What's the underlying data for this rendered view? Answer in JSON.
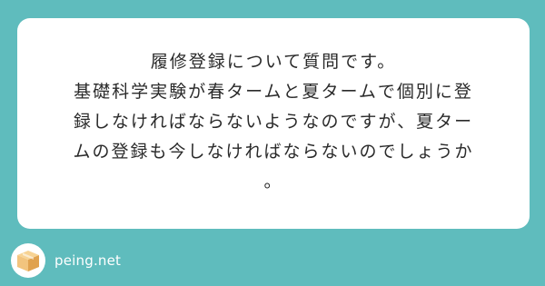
{
  "question": {
    "lines": [
      "履修登録について質問です。",
      "基礎科学実験が春タームと夏タームで個別に登",
      "録しなければならないようなのですが、夏ター",
      "ムの登録も今しなければならないのでしょうか",
      "。"
    ]
  },
  "footer": {
    "logo_icon": "box-icon",
    "brand": "peing.net"
  },
  "colors": {
    "background": "#5fbcbd",
    "card": "#ffffff",
    "box_light": "#f2c47e",
    "box_dark": "#e0a24f"
  }
}
